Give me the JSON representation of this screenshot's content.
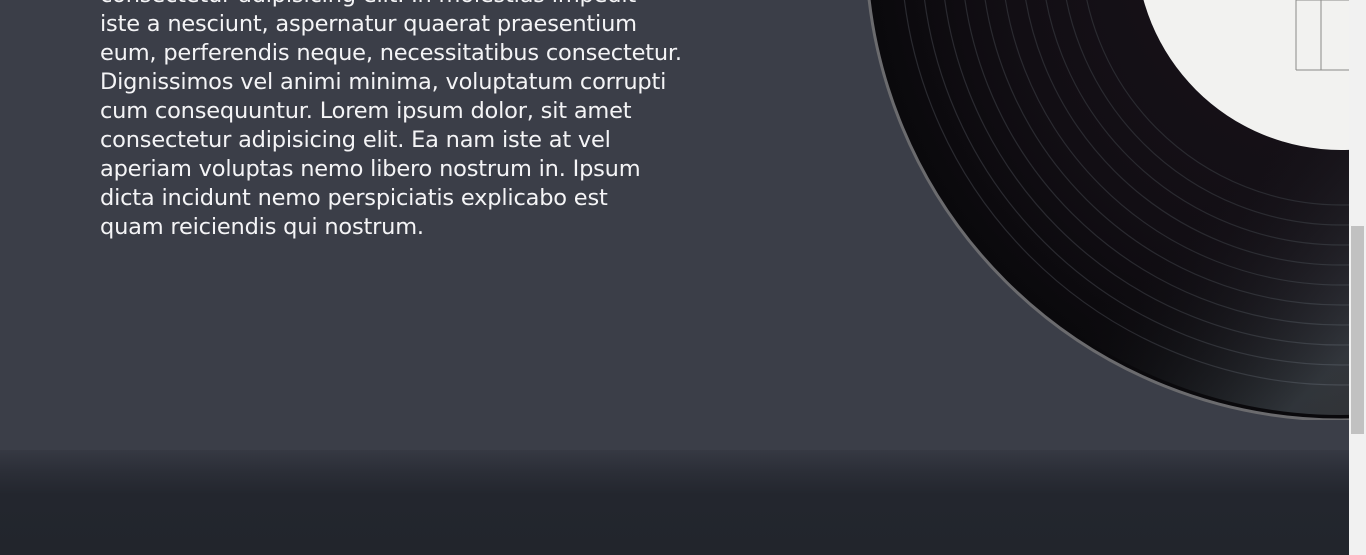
{
  "main": {
    "body_text": "consectetur adipisicing elit. In molestias impedit\niste a nesciunt, aspernatur quaerat praesentium\neum, perferendis neque, necessitatibus consectetur.\nDignissimos vel animi minima, voluptatum corrupti\ncum consequuntur. Lorem ipsum dolor, sit amet\nconsectetur adipisicing elit. Ea nam iste at vel\naperiam voluptas nemo libero nostrum in. Ipsum\ndicta incidunt nemo perspiciatis explicabo est\nquam reiciendis qui nostrum."
  },
  "colors": {
    "section_background": "#3b3e48",
    "footer_background": "#22252c",
    "text": "#f4f4f6",
    "record_vinyl": "#0d0b10",
    "record_label": "#f2f2f0"
  },
  "icons": {
    "record": "vinyl-record-image"
  }
}
